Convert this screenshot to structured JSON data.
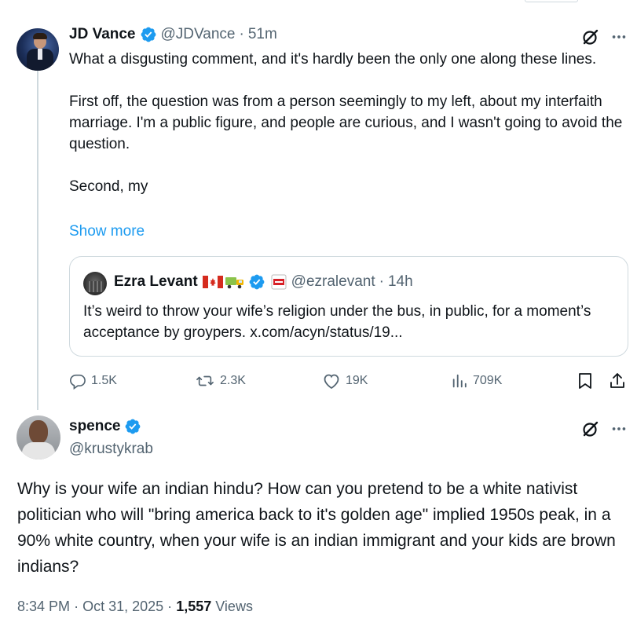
{
  "reply_to": {
    "author": {
      "name": "JD Vance",
      "handle": "@JDVance",
      "time": "51m",
      "verified": true,
      "avatar": "jd-vance-avatar"
    },
    "text": "What a disgusting comment, and it's hardly been the only one along these lines.\n\nFirst off, the question was from a person seemingly to my left, about my interfaith marriage. I'm a public figure, and people are curious, and I wasn't going to avoid the question.\n\nSecond, my",
    "show_more": "Show more",
    "quoted": {
      "name": "Ezra Levant",
      "emojis": [
        "canada-flag",
        "truck",
        "rebel-news-badge"
      ],
      "handle": "@ezralevant",
      "time": "14h",
      "verified": true,
      "text": "It’s weird to throw your wife’s religion under the bus, in public, for a moment’s acceptance by groypers. x.com/acyn/status/19..."
    },
    "stats": {
      "replies": "1.5K",
      "reposts": "2.3K",
      "likes": "19K",
      "views": "709K"
    }
  },
  "main": {
    "author": {
      "name": "spence",
      "handle": "@krustykrab",
      "verified": true,
      "avatar": "spence-avatar"
    },
    "text": "Why is your wife an indian hindu? How can you pretend to be a white nativist politician who will \"bring america back to it's golden age\" implied 1950s peak, in a 90% white country, when your wife is an indian immigrant and your kids are brown indians?",
    "time": "8:34 PM",
    "date": "Oct 31, 2025",
    "views_count": "1,557",
    "views_label": "Views"
  },
  "sep": "·",
  "colors": {
    "accent": "#1d9bf0",
    "secondary_text": "#536471",
    "border": "#cfd9de"
  }
}
